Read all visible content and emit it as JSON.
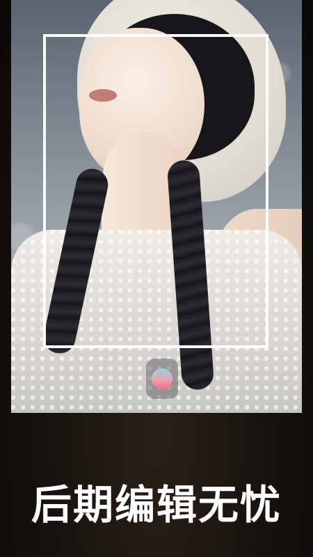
{
  "headline": "后期编辑无忧",
  "photo": {
    "icon": "portrait-photo"
  },
  "record_button": {
    "icon": "gradient-record-icon",
    "colors": [
      "#8fd6e6",
      "#f0a0ad",
      "#f06f86"
    ]
  },
  "colors": {
    "background": "#0e0b09",
    "frame": "#ffffff",
    "headline": "#ffffff"
  }
}
